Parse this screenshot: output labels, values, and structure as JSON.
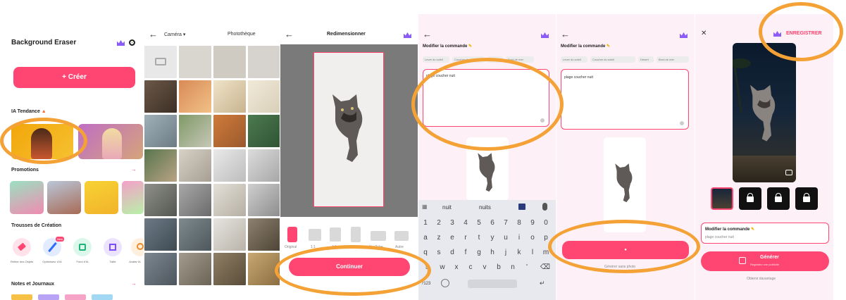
{
  "colors": {
    "accent": "#ff4672",
    "highlight_oval": "#f4a236",
    "premium": "#8b5cf6"
  },
  "screen1": {
    "title": "Background Eraser",
    "create_button": "+ Créer",
    "trending_title": "IA Tendance",
    "promo_title": "Promotions",
    "tools_title": "Trousses de Création",
    "tools": [
      {
        "label": "Retirer des Objets",
        "icon": "eraser-icon"
      },
      {
        "label": "Optimiseur d'IA",
        "icon": "magic-wand-icon",
        "badge": "New"
      },
      {
        "label": "Fond d'IA",
        "icon": "image-background-icon"
      },
      {
        "label": "Taille",
        "icon": "resize-icon"
      },
      {
        "label": "Avatar IA",
        "icon": "avatar-icon"
      }
    ],
    "notes_title": "Notes et Journaux"
  },
  "screen2": {
    "album": "Caméra",
    "album_dropdown": "▾",
    "library": "Photothèque"
  },
  "screen3": {
    "title": "Redimensionner",
    "tools": [
      "Original",
      "1:1",
      "4:5",
      "Story",
      "YouTube",
      "Autre"
    ],
    "continue_button": "Continuer"
  },
  "screen4": {
    "heading": "Modifier la commande",
    "chips": [
      "Lever du soleil",
      "Coucher du soleil",
      "Plage",
      "Bord de mer"
    ],
    "prompt_value": "plage coucher nuit",
    "suggestions": [
      "nuit",
      "nuits"
    ],
    "keyboard_rows": [
      [
        "1",
        "2",
        "3",
        "4",
        "5",
        "6",
        "7",
        "8",
        "9",
        "0"
      ],
      [
        "a",
        "z",
        "e",
        "r",
        "t",
        "y",
        "u",
        "i",
        "o",
        "p"
      ],
      [
        "q",
        "s",
        "d",
        "f",
        "g",
        "h",
        "j",
        "k",
        "l",
        "m"
      ],
      [
        "w",
        "x",
        "c",
        "v",
        "b",
        "n",
        "'"
      ]
    ],
    "keyboard_mode": "?123"
  },
  "screen5": {
    "heading": "Modifier la commande",
    "chips": [
      "Lever du soleil",
      "Coucher du soleil",
      "Désert",
      "Bord de mer"
    ],
    "prompt_value": "plage coucher nuit",
    "generate_symbol": "●",
    "footnote": "Générer sans photo"
  },
  "screen6": {
    "save_button": "ENREGISTRER",
    "heading": "Modifier la commande",
    "prompt_value": "plage coucher nuit",
    "generate_button": "Générer",
    "generate_sub": "Regardez une publicité",
    "footnote": "Obtenir davantage"
  }
}
